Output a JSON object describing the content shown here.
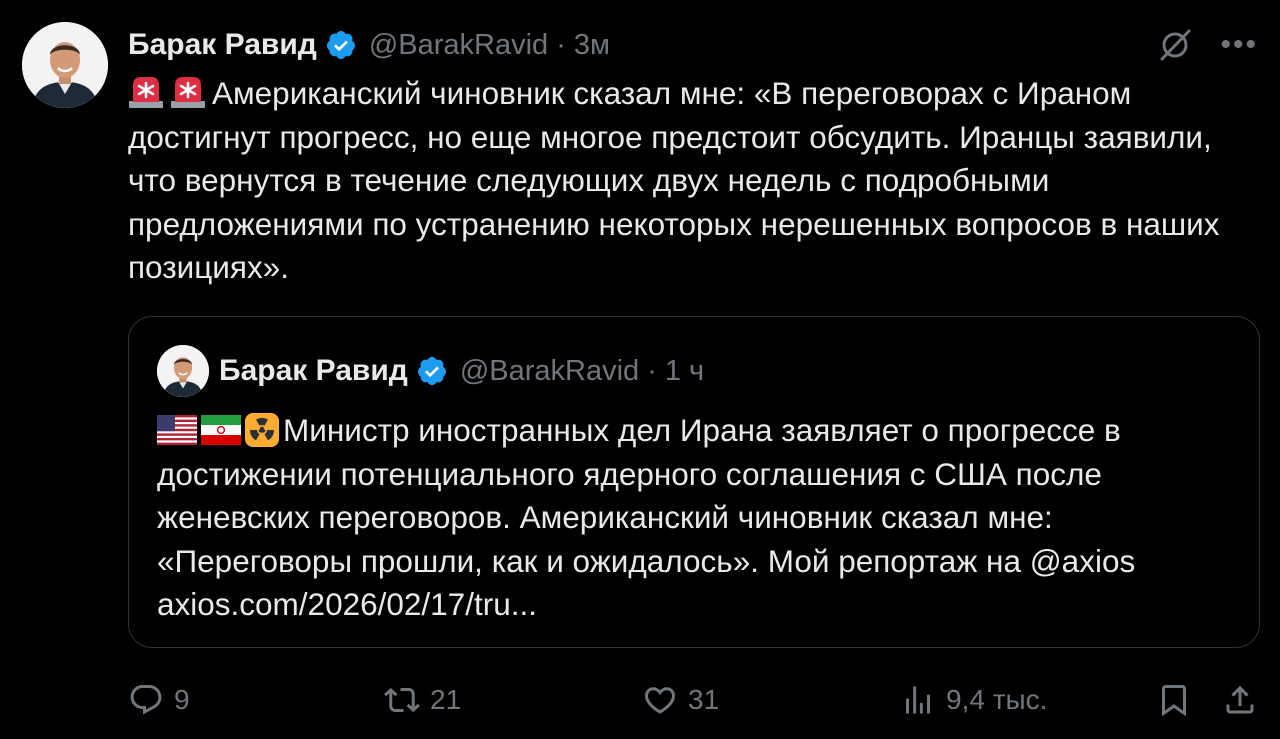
{
  "tweet": {
    "author_name": "Барак Равид",
    "handle": "@BarakRavid",
    "separator": "·",
    "time": "3м",
    "emoji_prefix": [
      "siren",
      "siren"
    ],
    "text": "Американский чиновник сказал мне: «В переговорах с Ираном достигнут прогресс, но еще многое предстоит обсудить. Иранцы заявили, что вернутся в течение следующих двух недель с подробными предложениями по устранению некоторых нерешенных вопросов в наших позициях»."
  },
  "quoted_tweet": {
    "author_name": "Барак Равид",
    "handle": "@BarakRavid",
    "separator": "·",
    "time": "1 ч",
    "emoji_prefix": [
      "us-flag",
      "iran-flag",
      "radioactive"
    ],
    "text": "Министр иностранных дел Ирана заявляет о прогрессе в достижении потенциального ядерного соглашения с США после женевских переговоров. Американский чиновник сказал мне: «Переговоры прошли, как и ожидалось». Мой репортаж на @axios axios.com/2026/02/17/tru..."
  },
  "actions": {
    "reply_count": "9",
    "retweet_count": "21",
    "like_count": "31",
    "views_count": "9,4 тыс."
  },
  "colors": {
    "background": "#000000",
    "text": "#e7e9ea",
    "muted": "#71767b",
    "verified": "#1d9bf0",
    "border": "#2f3336"
  }
}
